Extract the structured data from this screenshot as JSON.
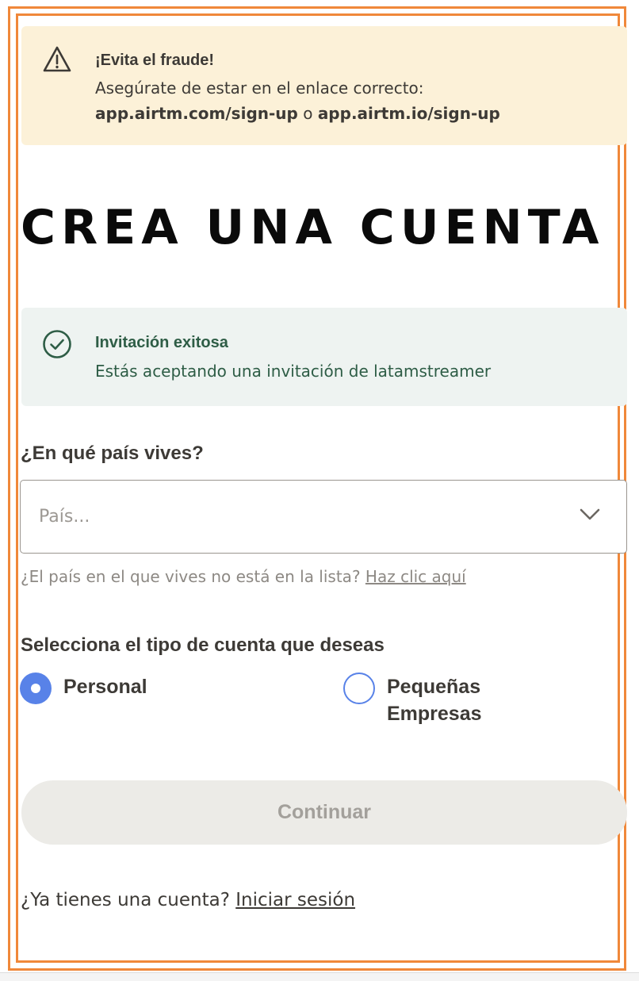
{
  "warning": {
    "icon": "warning-triangle-icon",
    "title": "¡Evita el fraude!",
    "line1": "Asegúrate de estar en el enlace correcto:",
    "link1": "app.airtm.com/sign-up",
    "connector": " o ",
    "link2": "app.airtm.io/sign-up",
    "background": "#fcf1d8"
  },
  "page_title": "CREA UNA CUENTA",
  "invitation": {
    "icon": "check-circle-icon",
    "title": "Invitación exitosa",
    "text": "Estás aceptando una invitación de latamstreamer",
    "background": "#eef3f1",
    "color": "#2e5d46"
  },
  "country": {
    "label": "¿En qué país vives?",
    "placeholder": "País...",
    "icon": "chevron-down-icon",
    "help_text": "¿El país en el que vives no está en la lista? ",
    "help_link": "Haz clic aquí"
  },
  "account_type": {
    "label": "Selecciona el tipo de cuenta que deseas",
    "options": [
      {
        "label": "Personal",
        "selected": true
      },
      {
        "label_line1": "Pequeñas",
        "label_line2": "Empresas",
        "selected": false
      }
    ],
    "accent": "#5882e8"
  },
  "continue_button": {
    "label": "Continuar",
    "disabled": true
  },
  "signin": {
    "text": "¿Ya tienes una cuenta? ",
    "link": "Iniciar sesión"
  },
  "frame_color": "#f0883a"
}
